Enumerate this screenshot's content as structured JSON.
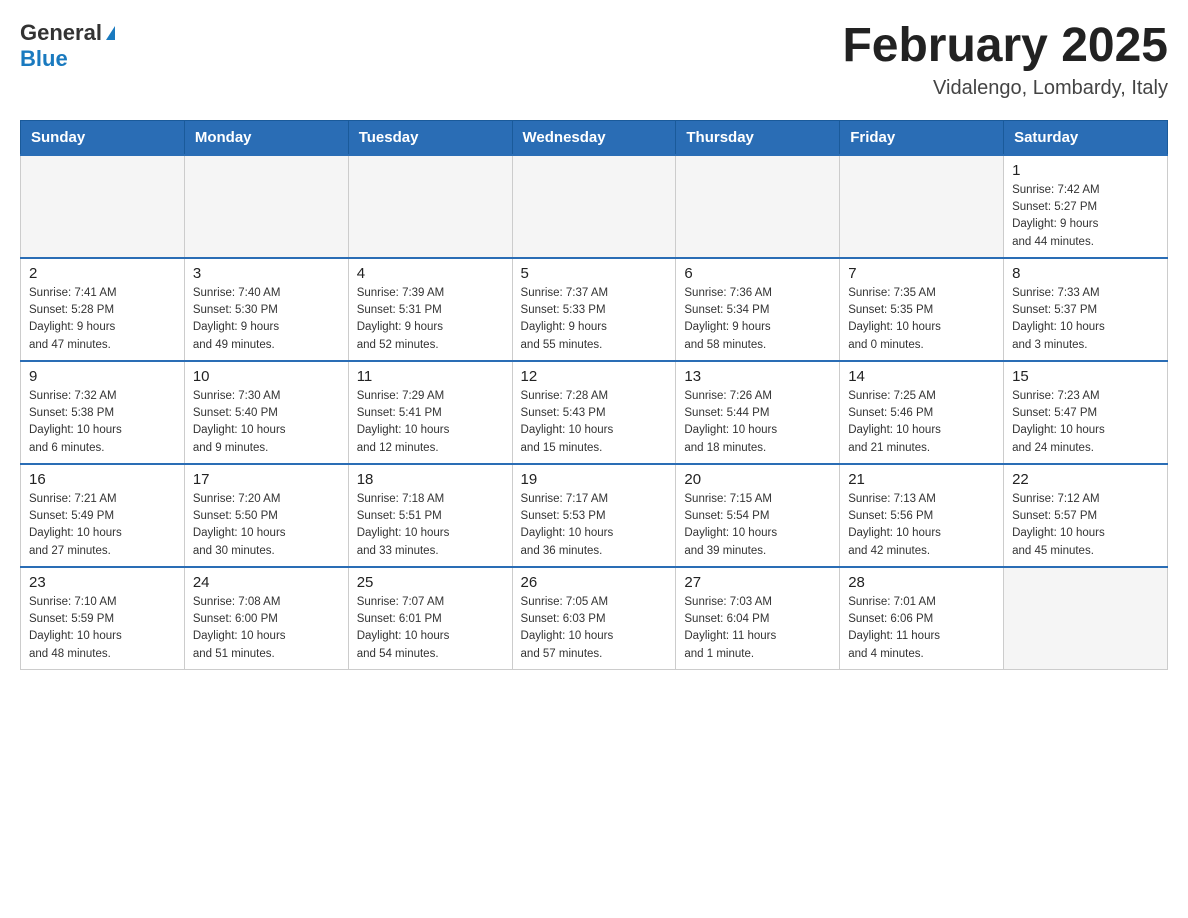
{
  "header": {
    "logo": {
      "general": "General",
      "blue": "Blue"
    },
    "title": "February 2025",
    "location": "Vidalengo, Lombardy, Italy"
  },
  "weekdays": [
    "Sunday",
    "Monday",
    "Tuesday",
    "Wednesday",
    "Thursday",
    "Friday",
    "Saturday"
  ],
  "weeks": [
    [
      {
        "day": "",
        "info": ""
      },
      {
        "day": "",
        "info": ""
      },
      {
        "day": "",
        "info": ""
      },
      {
        "day": "",
        "info": ""
      },
      {
        "day": "",
        "info": ""
      },
      {
        "day": "",
        "info": ""
      },
      {
        "day": "1",
        "info": "Sunrise: 7:42 AM\nSunset: 5:27 PM\nDaylight: 9 hours\nand 44 minutes."
      }
    ],
    [
      {
        "day": "2",
        "info": "Sunrise: 7:41 AM\nSunset: 5:28 PM\nDaylight: 9 hours\nand 47 minutes."
      },
      {
        "day": "3",
        "info": "Sunrise: 7:40 AM\nSunset: 5:30 PM\nDaylight: 9 hours\nand 49 minutes."
      },
      {
        "day": "4",
        "info": "Sunrise: 7:39 AM\nSunset: 5:31 PM\nDaylight: 9 hours\nand 52 minutes."
      },
      {
        "day": "5",
        "info": "Sunrise: 7:37 AM\nSunset: 5:33 PM\nDaylight: 9 hours\nand 55 minutes."
      },
      {
        "day": "6",
        "info": "Sunrise: 7:36 AM\nSunset: 5:34 PM\nDaylight: 9 hours\nand 58 minutes."
      },
      {
        "day": "7",
        "info": "Sunrise: 7:35 AM\nSunset: 5:35 PM\nDaylight: 10 hours\nand 0 minutes."
      },
      {
        "day": "8",
        "info": "Sunrise: 7:33 AM\nSunset: 5:37 PM\nDaylight: 10 hours\nand 3 minutes."
      }
    ],
    [
      {
        "day": "9",
        "info": "Sunrise: 7:32 AM\nSunset: 5:38 PM\nDaylight: 10 hours\nand 6 minutes."
      },
      {
        "day": "10",
        "info": "Sunrise: 7:30 AM\nSunset: 5:40 PM\nDaylight: 10 hours\nand 9 minutes."
      },
      {
        "day": "11",
        "info": "Sunrise: 7:29 AM\nSunset: 5:41 PM\nDaylight: 10 hours\nand 12 minutes."
      },
      {
        "day": "12",
        "info": "Sunrise: 7:28 AM\nSunset: 5:43 PM\nDaylight: 10 hours\nand 15 minutes."
      },
      {
        "day": "13",
        "info": "Sunrise: 7:26 AM\nSunset: 5:44 PM\nDaylight: 10 hours\nand 18 minutes."
      },
      {
        "day": "14",
        "info": "Sunrise: 7:25 AM\nSunset: 5:46 PM\nDaylight: 10 hours\nand 21 minutes."
      },
      {
        "day": "15",
        "info": "Sunrise: 7:23 AM\nSunset: 5:47 PM\nDaylight: 10 hours\nand 24 minutes."
      }
    ],
    [
      {
        "day": "16",
        "info": "Sunrise: 7:21 AM\nSunset: 5:49 PM\nDaylight: 10 hours\nand 27 minutes."
      },
      {
        "day": "17",
        "info": "Sunrise: 7:20 AM\nSunset: 5:50 PM\nDaylight: 10 hours\nand 30 minutes."
      },
      {
        "day": "18",
        "info": "Sunrise: 7:18 AM\nSunset: 5:51 PM\nDaylight: 10 hours\nand 33 minutes."
      },
      {
        "day": "19",
        "info": "Sunrise: 7:17 AM\nSunset: 5:53 PM\nDaylight: 10 hours\nand 36 minutes."
      },
      {
        "day": "20",
        "info": "Sunrise: 7:15 AM\nSunset: 5:54 PM\nDaylight: 10 hours\nand 39 minutes."
      },
      {
        "day": "21",
        "info": "Sunrise: 7:13 AM\nSunset: 5:56 PM\nDaylight: 10 hours\nand 42 minutes."
      },
      {
        "day": "22",
        "info": "Sunrise: 7:12 AM\nSunset: 5:57 PM\nDaylight: 10 hours\nand 45 minutes."
      }
    ],
    [
      {
        "day": "23",
        "info": "Sunrise: 7:10 AM\nSunset: 5:59 PM\nDaylight: 10 hours\nand 48 minutes."
      },
      {
        "day": "24",
        "info": "Sunrise: 7:08 AM\nSunset: 6:00 PM\nDaylight: 10 hours\nand 51 minutes."
      },
      {
        "day": "25",
        "info": "Sunrise: 7:07 AM\nSunset: 6:01 PM\nDaylight: 10 hours\nand 54 minutes."
      },
      {
        "day": "26",
        "info": "Sunrise: 7:05 AM\nSunset: 6:03 PM\nDaylight: 10 hours\nand 57 minutes."
      },
      {
        "day": "27",
        "info": "Sunrise: 7:03 AM\nSunset: 6:04 PM\nDaylight: 11 hours\nand 1 minute."
      },
      {
        "day": "28",
        "info": "Sunrise: 7:01 AM\nSunset: 6:06 PM\nDaylight: 11 hours\nand 4 minutes."
      },
      {
        "day": "",
        "info": ""
      }
    ]
  ]
}
